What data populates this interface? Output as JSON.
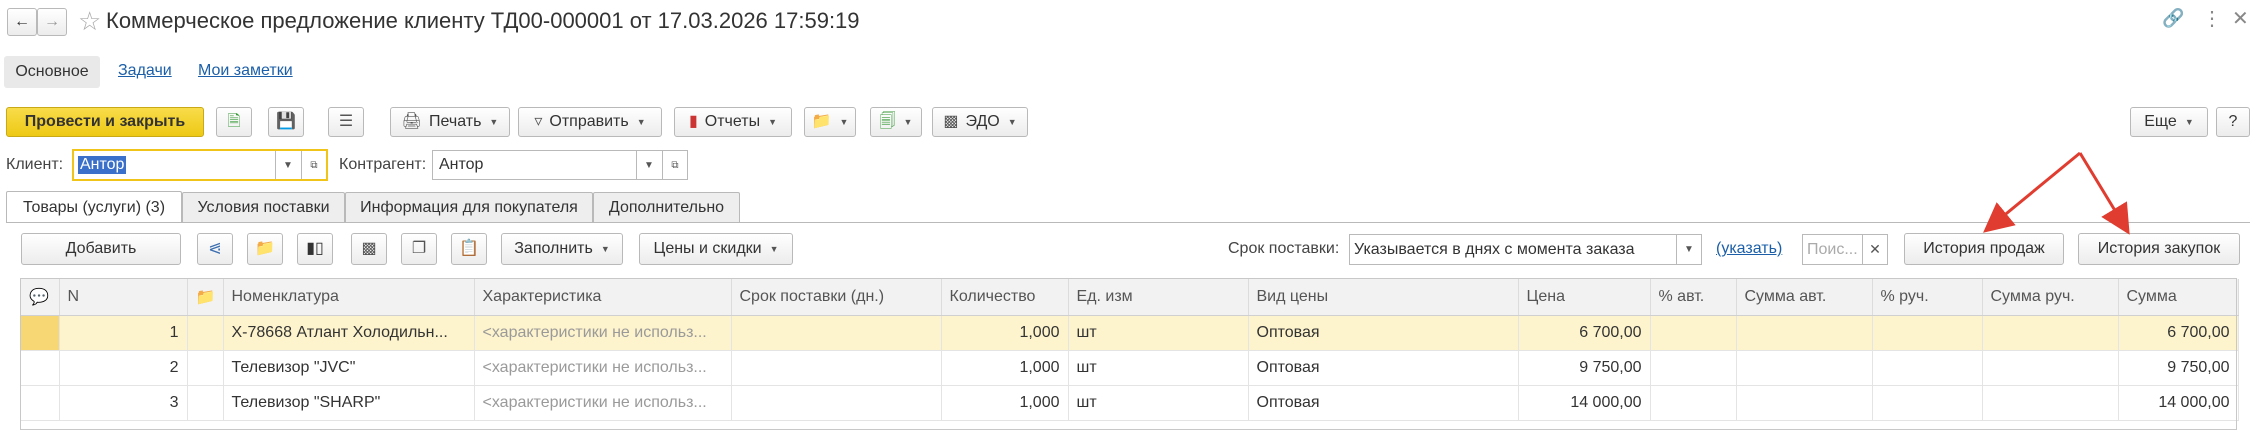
{
  "header": {
    "back_icon": "arrow-left-icon",
    "forward_icon": "arrow-right-icon",
    "star_icon": "star-icon",
    "title": "Коммерческое предложение клиенту ТД00-000001 от 17.03.2026 17:59:19",
    "link_icon": "link-icon",
    "more_icon": "vertical-dots-icon",
    "close_icon": "close-icon"
  },
  "nav": {
    "main": "Основное",
    "tasks": "Задачи",
    "notes": "Мои заметки"
  },
  "toolbar": {
    "post_close": "Провести и закрыть",
    "print": "Печать",
    "send": "Отправить",
    "reports": "Отчеты",
    "edo": "ЭДО",
    "more": "Еще",
    "help": "?"
  },
  "fields": {
    "client_label": "Клиент:",
    "client_value": "Антор",
    "counterparty_label": "Контрагент:",
    "counterparty_value": "Антор"
  },
  "tabs": [
    {
      "label": "Товары (услуги) (3)"
    },
    {
      "label": "Условия поставки"
    },
    {
      "label": "Информация для покупателя"
    },
    {
      "label": "Дополнительно"
    }
  ],
  "table_toolbar": {
    "add": "Добавить",
    "fill": "Заполнить",
    "prices": "Цены и скидки",
    "delivery_label": "Срок поставки:",
    "delivery_value": "Указывается в днях с момента заказа",
    "specify_link": "(указать)",
    "search_placeholder": "Поис...",
    "sales_history": "История продаж",
    "purchase_history": "История закупок"
  },
  "table": {
    "columns": [
      "N",
      "Номенклатура",
      "Характеристика",
      "Срок поставки (дн.)",
      "Количество",
      "Ед. изм",
      "Вид цены",
      "Цена",
      "% авт.",
      "Сумма авт.",
      "% руч.",
      "Сумма руч.",
      "Сумма"
    ],
    "rows": [
      {
        "n": "1",
        "item": "Х-78668 Атлант Холодильн...",
        "char": "<характеристики не использ...",
        "term": "",
        "qty": "1,000",
        "unit": "шт",
        "price_type": "Оптовая",
        "price": "6 700,00",
        "pct_auto": "",
        "sum_auto": "",
        "pct_man": "",
        "sum_man": "",
        "sum": "6 700,00"
      },
      {
        "n": "2",
        "item": "Телевизор \"JVC\"",
        "char": "<характеристики не использ...",
        "term": "",
        "qty": "1,000",
        "unit": "шт",
        "price_type": "Оптовая",
        "price": "9 750,00",
        "pct_auto": "",
        "sum_auto": "",
        "pct_man": "",
        "sum_man": "",
        "sum": "9 750,00"
      },
      {
        "n": "3",
        "item": "Телевизор \"SHARP\"",
        "char": "<характеристики не использ...",
        "term": "",
        "qty": "1,000",
        "unit": "шт",
        "price_type": "Оптовая",
        "price": "14 000,00",
        "pct_auto": "",
        "sum_auto": "",
        "pct_man": "",
        "sum_man": "",
        "sum": "14 000,00"
      }
    ]
  },
  "colors": {
    "primary_button": "#f5d32e",
    "selected_row": "#fdf3cc",
    "annotation_arrow": "#e03c2f",
    "link": "#1c5fa8"
  }
}
